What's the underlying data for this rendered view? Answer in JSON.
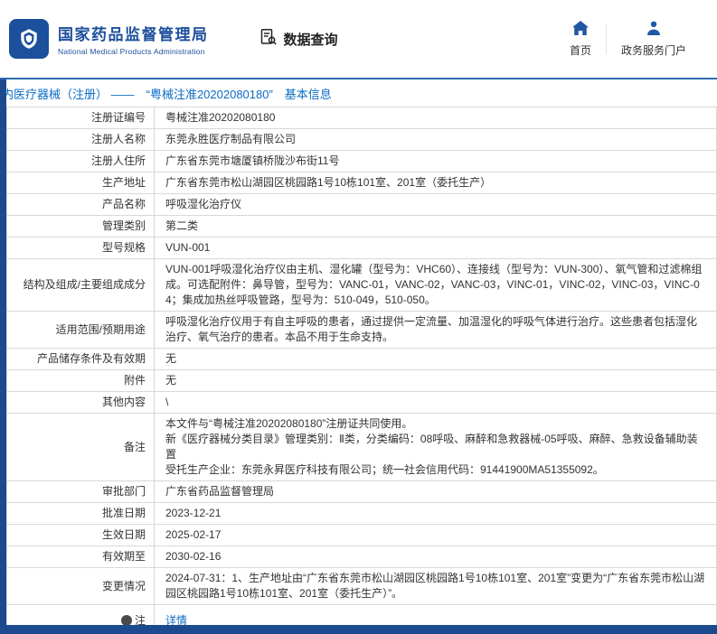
{
  "header": {
    "logo_title": "国家药品监督管理局",
    "logo_subtitle": "National Medical Products Administration",
    "section_title": "数据查询",
    "nav": [
      {
        "label": "首页",
        "icon": "home-icon"
      },
      {
        "label": "政务服务门户",
        "icon": "person-icon"
      }
    ]
  },
  "breadcrumb": {
    "text": "内医疗器械（注册） ——　“粤械注准20202080180”　基本信息"
  },
  "table": {
    "rows": [
      {
        "label": "注册证编号",
        "value": "粤械注准20202080180"
      },
      {
        "label": "注册人名称",
        "value": "东莞永胜医疗制品有限公司"
      },
      {
        "label": "注册人住所",
        "value": "广东省东莞市塘厦镇桥陇沙布街11号"
      },
      {
        "label": "生产地址",
        "value": "广东省东莞市松山湖园区桃园路1号10栋101室、201室（委托生产）"
      },
      {
        "label": "产品名称",
        "value": "呼吸湿化治疗仪"
      },
      {
        "label": "管理类别",
        "value": "第二类"
      },
      {
        "label": "型号规格",
        "value": "VUN-001"
      },
      {
        "label": "结构及组成/主要组成成分",
        "value": "VUN-001呼吸湿化治疗仪由主机、湿化罐（型号为：VHC60）、连接线（型号为：VUN-300）、氧气管和过滤棉组成。可选配附件：鼻导管，型号为：VANC-01，VANC-02，VANC-03，VINC-01，VINC-02，VINC-03，VINC-04；集成加热丝呼吸管路，型号为：510-049，510-050。"
      },
      {
        "label": "适用范围/预期用途",
        "value": "呼吸湿化治疗仪用于有自主呼吸的患者，通过提供一定流量、加温湿化的呼吸气体进行治疗。这些患者包括湿化治疗、氧气治疗的患者。本品不用于生命支持。"
      },
      {
        "label": "产品储存条件及有效期",
        "value": "无"
      },
      {
        "label": "附件",
        "value": "无"
      },
      {
        "label": "其他内容",
        "value": "\\"
      },
      {
        "label": "备注",
        "value": "本文件与“粤械注准20202080180”注册证共同使用。\n新《医疗器械分类目录》管理类别：Ⅱ类，分类编码：08呼吸、麻醉和急救器械-05呼吸、麻醉、急救设备辅助装置\n受托生产企业：东莞永昇医疗科技有限公司；统一社会信用代码：91441900MA51355092。"
      },
      {
        "label": "审批部门",
        "value": "广东省药品监督管理局"
      },
      {
        "label": "批准日期",
        "value": "2023-12-21"
      },
      {
        "label": "生效日期",
        "value": "2025-02-17"
      },
      {
        "label": "有效期至",
        "value": "2030-02-16"
      },
      {
        "label": "变更情况",
        "value": "2024-07-31：1、生产地址由“广东省东莞市松山湖园区桃园路1号10栋101室、201室”变更为“广东省东莞市松山湖园区桃园路1号10栋101室、201室（委托生产）”。"
      },
      {
        "label": "注",
        "value": "详情",
        "link": true,
        "icon": "note-icon"
      }
    ]
  },
  "colors": {
    "brand_blue": "#1c4f9c",
    "bar_blue": "#1b4a8f",
    "link_blue": "#0b6cc4",
    "header_line_blue": "#2e6cb3",
    "border_gray": "#d8d8d8",
    "text_dark": "#333333"
  }
}
